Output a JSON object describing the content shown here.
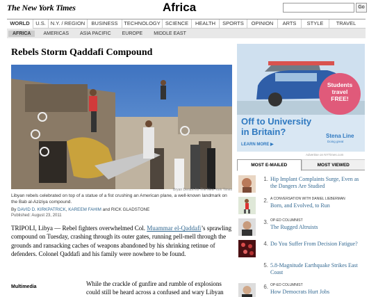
{
  "masthead": {
    "logo": "The New York Times",
    "section": "Africa",
    "search_value": "",
    "go_label": "Go"
  },
  "nav": {
    "main": [
      "World",
      "U.S.",
      "N.Y. / Region",
      "Business",
      "Technology",
      "Science",
      "Health",
      "Sports",
      "Opinion",
      "Arts",
      "Style",
      "Travel"
    ],
    "sub": [
      "Africa",
      "Americas",
      "Asia Pacific",
      "Europe",
      "Middle East"
    ]
  },
  "article": {
    "headline": "Rebels Storm Qaddafi Compound",
    "photo_credit": "Bryan Denton for The New York Times",
    "caption": "Libyan rebels celebrated on top of a statue of a fist crushing an American plane, a well-known landmark on the Bab al-Aziziya compound.",
    "byline_prefix": "By",
    "author1": "DAVID D. KIRKPATRICK",
    "author2": "KAREEM FAHIM",
    "byline_and": "and",
    "author3": "RICK GLADSTONE",
    "published": "Published: August 23, 2011",
    "lede_1": "TRIPOLI, Libya — Rebel fighters overwhelmed Col.",
    "lede_link": "Muammar el-Qaddafi",
    "lede_2": "’s sprawling compound on Tuesday, crashing through its outer gates, running pell-mell through the grounds and ransacking caches of weapons abandoned by his shrinking retinue of defenders. Colonel Qaddafi and his family were nowhere to be found.",
    "multimedia": "Multimedia",
    "body": "While the crackle of gunfire and rumble of explosions could still be heard across a confused and wary Libyan"
  },
  "ad": {
    "headline_1": "Off to University",
    "headline_2": "in Britain?",
    "badge_1": "Students",
    "badge_2": "travel",
    "badge_3": "FREE!",
    "learn_more": "LEARN MORE ▶",
    "brand": "Stena Line",
    "tagline": "Doing great",
    "note": "Advertise on NYTimes.com"
  },
  "most": {
    "tab_emailed": "MOST E-MAILED",
    "tab_viewed": "MOST VIEWED",
    "items": [
      {
        "num": "1.",
        "kicker": "",
        "title": "Hip Implant Complaints Surge, Even as the Dangers Are Studied"
      },
      {
        "num": "2.",
        "kicker": "A CONVERSATION WITH DANIEL LIEBERMAN",
        "title": "Born, and Evolved, to Run"
      },
      {
        "num": "3.",
        "kicker": "OP-ED COLUMNIST",
        "title": "The Rugged Altruists"
      },
      {
        "num": "4.",
        "kicker": "",
        "title": "Do You Suffer From Decision Fatigue?"
      },
      {
        "num": "5.",
        "kicker": "",
        "title": "5.8-Magnitude Earthquake Strikes East Coast"
      },
      {
        "num": "6.",
        "kicker": "OP-ED COLUMNIST",
        "title": "How Democrats Hurt Jobs"
      }
    ]
  },
  "colors": {
    "link": "#326891",
    "ad_blue": "#2f79c0",
    "badge": "#e05a7a"
  }
}
